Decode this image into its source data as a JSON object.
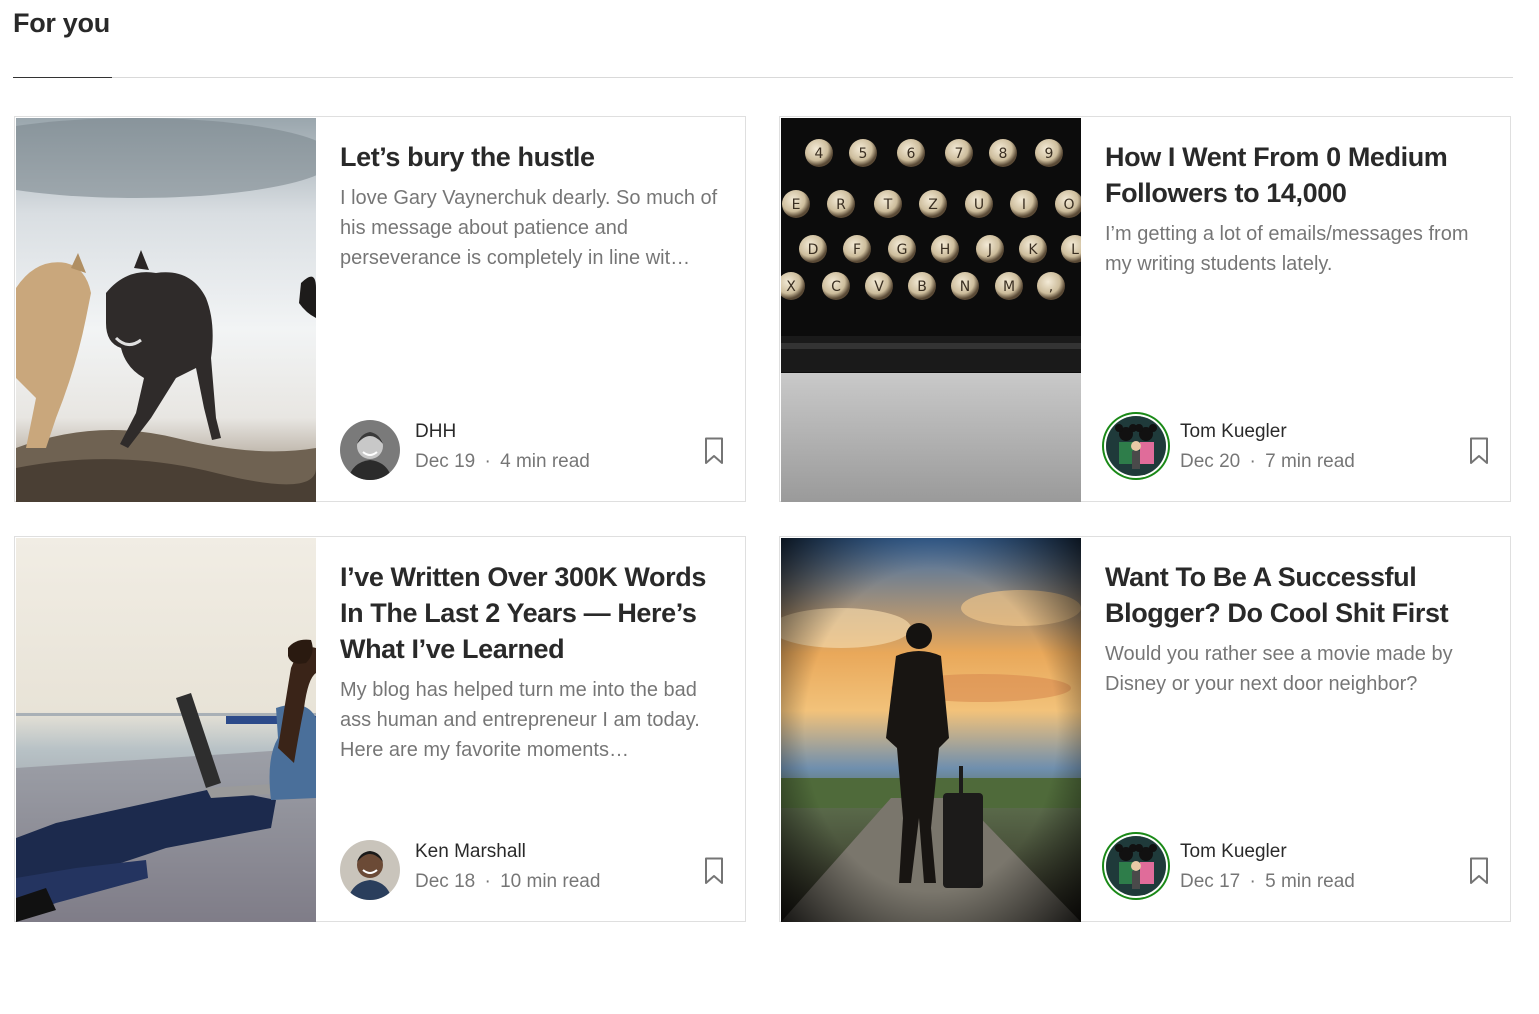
{
  "section": {
    "title": "For you"
  },
  "cards": [
    {
      "title": "Let’s bury the hustle",
      "snippet": "I love Gary Vaynerchuk dearly. So much of his message about patience and perseverance is completely in line wit…",
      "author": "DHH",
      "date": "Dec 19",
      "separator": "·",
      "read_time": "4 min read"
    },
    {
      "title": "How I Went From 0 Medium Followers to 14,000",
      "snippet": "I’m getting a lot of emails/messages from my writing students lately.",
      "author": "Tom Kuegler",
      "date": "Dec 20",
      "separator": "·",
      "read_time": "7 min read"
    },
    {
      "title": "I’ve Written Over 300K Words In The Last 2 Years — Here’s What I’ve Learned",
      "snippet": "My blog has helped turn me into the bad ass human and entrepreneur I am today. Here are my favorite moments…",
      "author": "Ken Marshall",
      "date": "Dec 18",
      "separator": "·",
      "read_time": "10 min read"
    },
    {
      "title": "Want To Be A Successful Blogger? Do Cool Shit First",
      "snippet": "Would you rather see a movie made by Disney or your next door neighbor?",
      "author": "Tom Kuegler",
      "date": "Dec 17",
      "separator": "·",
      "read_time": "5 min read"
    }
  ],
  "icons": {
    "bookmark": "bookmark-icon"
  },
  "colors": {
    "text_primary": "#292929",
    "text_secondary": "#757575",
    "border": "#dfdfdf",
    "follow_ring": "#1a8917"
  }
}
